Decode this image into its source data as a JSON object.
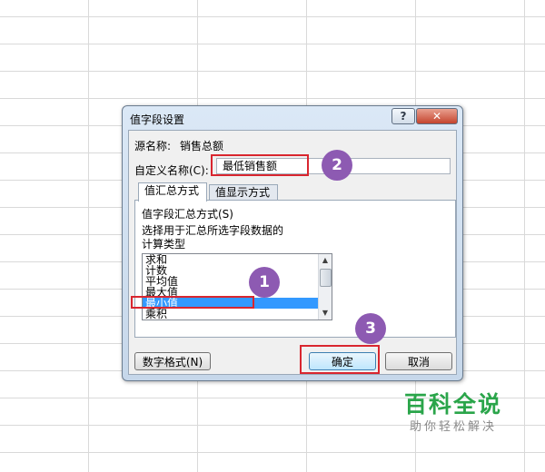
{
  "dialog": {
    "title": "值字段设置",
    "help_glyph": "?",
    "close_glyph": "✕",
    "source_label": "源名称:",
    "source_value": "销售总额",
    "custom_name_label": "自定义名称(C):",
    "custom_name_value": "最低销售额",
    "tabs": [
      {
        "label": "值汇总方式",
        "active": true
      },
      {
        "label": "值显示方式",
        "active": false
      }
    ],
    "summarize_label": "值字段汇总方式(S)",
    "instruction_line1": "选择用于汇总所选字段数据的",
    "instruction_line2": "计算类型",
    "list_items": [
      "求和",
      "计数",
      "平均值",
      "最大值",
      "最小值",
      "乘积"
    ],
    "selected_item": "最小值",
    "number_format_button": "数字格式(N)",
    "ok_button": "确定",
    "cancel_button": "取消"
  },
  "annotations": {
    "badge_1": "1",
    "badge_2": "2",
    "badge_3": "3",
    "highlight_color": "#d9262f",
    "badge_color": "#8d5ab2"
  },
  "watermark": {
    "main": "百科全说",
    "sub": "助你轻松解决"
  },
  "colors": {
    "selection": "#3399ff",
    "watermark_green": "#2aa54a"
  }
}
